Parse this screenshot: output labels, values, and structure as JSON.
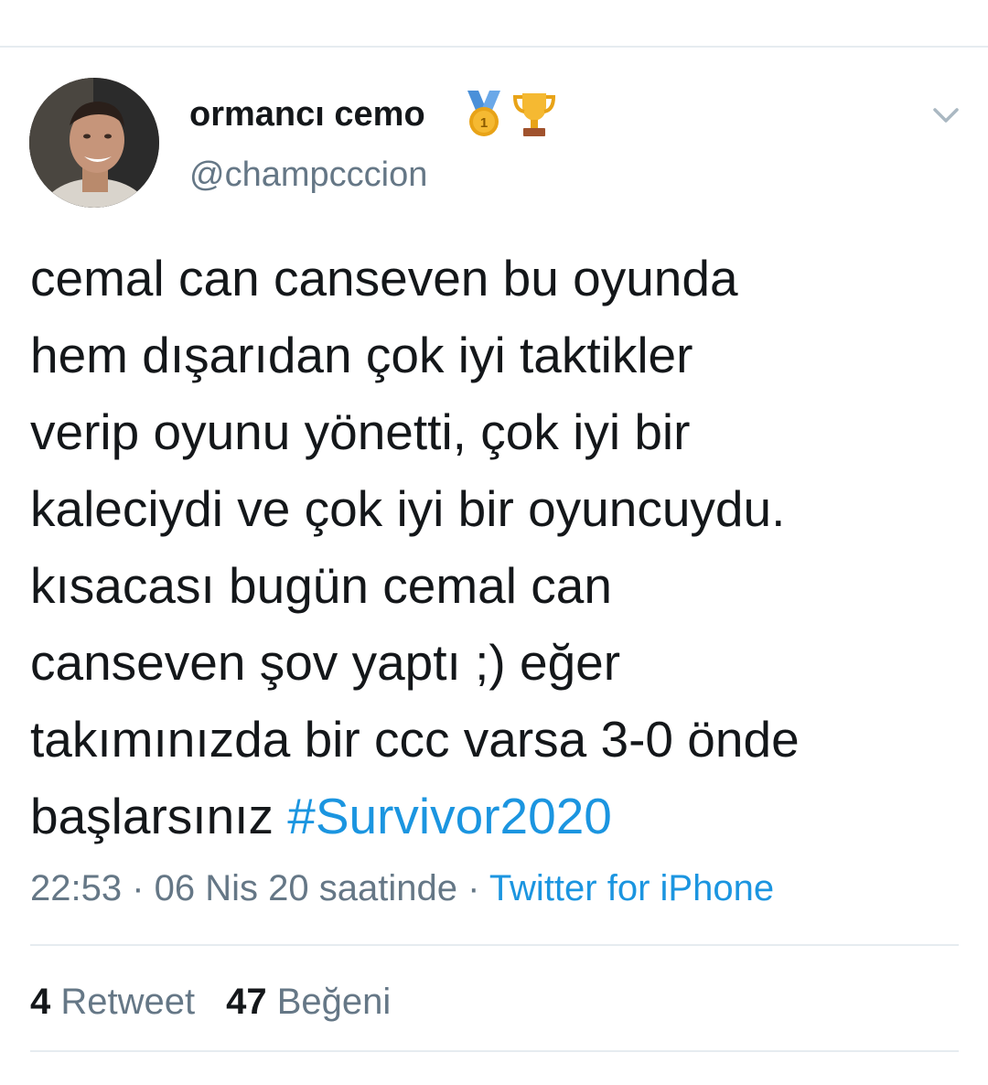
{
  "user": {
    "display_name": "ormancı cemo",
    "handle": "@champcccion",
    "badges": [
      "medal-icon",
      "trophy-icon"
    ],
    "avatar": "profile-photo"
  },
  "tweet": {
    "text": "cemal can canseven bu oyunda\nhem dışarıdan çok iyi taktikler\nverip oyunu yönetti, çok iyi bir\nkaleciydi ve çok iyi bir oyuncuydu.\nkısacası bugün cemal can\ncanseven şov yaptı ;) eğer\ntakımınızda bir ccc varsa 3-0 önde\nbaşlarsınız ",
    "hashtag": "#Survivor2020"
  },
  "meta": {
    "time": "22:53",
    "separator1": " · ",
    "date_label": "06 Nis 20 saatinde",
    "separator2": " · ",
    "source": "Twitter for iPhone"
  },
  "stats": {
    "retweets_count": "4",
    "retweets_label": "Retweet",
    "likes_count": "47",
    "likes_label": "Beğeni"
  },
  "colors": {
    "text": "#14171a",
    "secondary": "#657786",
    "link": "#1b95e0",
    "divider": "#e6ecf0"
  }
}
